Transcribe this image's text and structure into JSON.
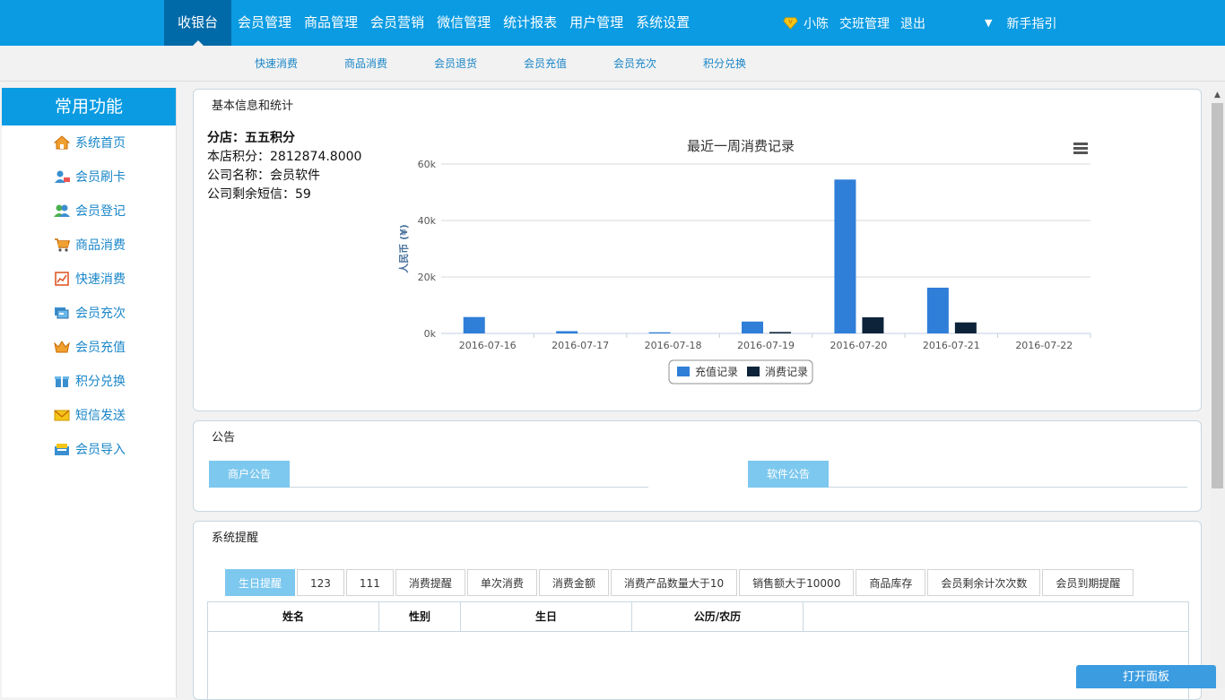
{
  "topnav": {
    "tabs": [
      "收银台",
      "会员管理",
      "商品管理",
      "会员营销",
      "微信管理",
      "统计报表",
      "用户管理",
      "系统设置"
    ]
  },
  "user": {
    "name": "小陈",
    "shift": "交班管理",
    "logout": "退出",
    "guide": "新手指引"
  },
  "subnav": [
    "快速消费",
    "商品消费",
    "会员退货",
    "会员充值",
    "会员充次",
    "积分兑换"
  ],
  "sidebar": {
    "title": "常用功能",
    "items": [
      {
        "label": "系统首页",
        "icon": "home-icon"
      },
      {
        "label": "会员刷卡",
        "icon": "card-swipe-icon"
      },
      {
        "label": "会员登记",
        "icon": "users-icon"
      },
      {
        "label": "商品消费",
        "icon": "cart-icon"
      },
      {
        "label": "快速消费",
        "icon": "chart-icon"
      },
      {
        "label": "会员充次",
        "icon": "recharge-count-icon"
      },
      {
        "label": "会员充值",
        "icon": "crown-icon"
      },
      {
        "label": "积分兑换",
        "icon": "gift-icon"
      },
      {
        "label": "短信发送",
        "icon": "mail-icon"
      },
      {
        "label": "会员导入",
        "icon": "import-icon"
      }
    ]
  },
  "stats": {
    "title": "基本信息和统计",
    "shop": "分店：五五积分",
    "points": "本店积分：2812874.8000",
    "company": "公司名称：会员软件",
    "sms": "公司剩余短信：59"
  },
  "chart_data": {
    "type": "bar",
    "title": "最近一周消费记录",
    "ylabel": "人民币 (¥)",
    "xlabel": "",
    "categories": [
      "2016-07-16",
      "2016-07-17",
      "2016-07-18",
      "2016-07-19",
      "2016-07-20",
      "2016-07-21",
      "2016-07-22"
    ],
    "series": [
      {
        "name": "充值记录",
        "color": "#2f7ed8",
        "values": [
          5800,
          800,
          400,
          4200,
          54500,
          16200,
          0
        ]
      },
      {
        "name": "消费记录",
        "color": "#0d233a",
        "values": [
          0,
          0,
          0,
          500,
          5700,
          3900,
          0
        ]
      }
    ],
    "ylim": [
      0,
      60000
    ],
    "yticks": [
      "0k",
      "20k",
      "40k",
      "60k"
    ],
    "grid": true,
    "legend": "bottom-center"
  },
  "notice": {
    "title": "公告",
    "merchant_tab": "商户公告",
    "software_tab": "软件公告"
  },
  "reminders": {
    "title": "系统提醒",
    "tabs": [
      "生日提醒",
      "123",
      "111",
      "消费提醒",
      "单次消费",
      "消费金额",
      "消费产品数量大于10",
      "销售额大于10000",
      "商品库存",
      "会员剩余计次次数",
      "会员到期提醒"
    ],
    "columns": [
      "姓名",
      "性别",
      "生日",
      "公历/农历"
    ]
  },
  "open_panel": "打开面板"
}
